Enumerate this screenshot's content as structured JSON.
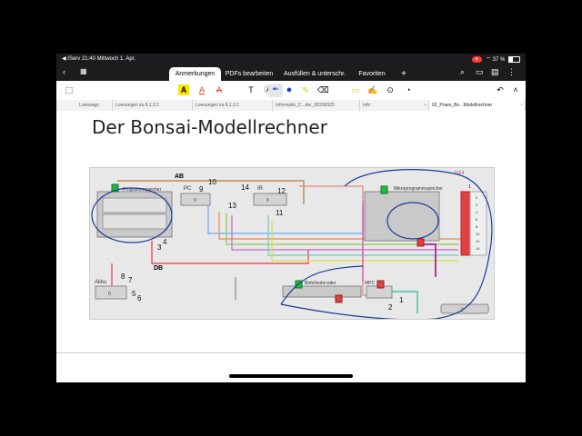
{
  "status": {
    "app": "◀ IServ",
    "time": "21:40",
    "date": "Mittwoch 1. Apr.",
    "battery": "37 %"
  },
  "nav": {
    "tabs": [
      "Anmerkungen",
      "PDFs bearbeiten",
      "Ausfüllen & unterschr.",
      "Favoriten"
    ],
    "add": "+"
  },
  "doc_tabs": [
    {
      "label": "Loesungs"
    },
    {
      "label": "Loesungen zu 8.1.3.1"
    },
    {
      "label": "Loesungen zu 8.1.3.1"
    },
    {
      "label": "Informatik_C...der_20200325"
    },
    {
      "label": "Info"
    },
    {
      "label": "02_Praes_Bo...Modellrechner"
    }
  ],
  "page": {
    "title": "Der Bonsai-Modellrechner"
  },
  "diagram": {
    "labels": {
      "ab": "AB",
      "db": "DB",
      "programmspeicher": "Programmspeicher",
      "pc": "PC",
      "ir": "IR",
      "akku": "Akku",
      "befehlsdecoder": "Befehlsdecoder",
      "mpc": "MPC",
      "mikroprogrammspeicher": "Mikroprogrammspeicher",
      "value_1024": "1024",
      "value_1": "1",
      "value_2": "2"
    },
    "numbers": {
      "n2": "2",
      "n3": "3",
      "n4": "4",
      "n5": "5",
      "n6": "6",
      "n7": "7",
      "n8": "8",
      "n9": "9",
      "n10": "10",
      "n11": "11",
      "n12": "12",
      "n13": "13",
      "n14": "14",
      "n1": "1",
      "n2b": "2"
    },
    "counters": {
      "zero": "0"
    },
    "row_labels": [
      "0",
      "1",
      "2",
      "3",
      "4",
      "5",
      "6",
      "7",
      "8",
      "9",
      "10",
      "11",
      "12",
      "13",
      "14"
    ]
  }
}
